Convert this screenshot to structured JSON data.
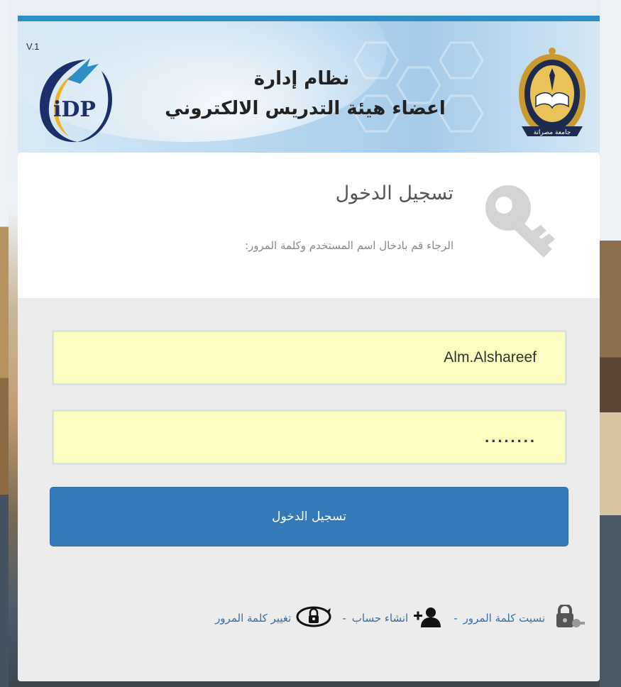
{
  "header": {
    "version": "V.1",
    "logo_text": "iDP",
    "title_line1": "نظام إدارة",
    "title_line2": "اعضاء هيئة التدريس الالكتروني",
    "crest_ribbon": "جامعة مصراتة"
  },
  "login": {
    "heading": "تسجيل الدخول",
    "subheading": "الرجاء قم بادخال اسم المستخدم وكلمة المرور:",
    "username_value": "Alm.Alshareef",
    "password_value": "........",
    "submit_label": "تسجيل الدخول"
  },
  "links": {
    "forgot_password": "نسيت كلمة المرور",
    "create_account": "انشاء حساب",
    "change_password": "تغيير كلمة المرور",
    "separator": "-"
  },
  "colors": {
    "accent": "#347ab7",
    "banner_border": "#2e8fc6",
    "input_bg": "#fbfdc0",
    "link": "#3a6ea5"
  },
  "icons": [
    "idp-logo",
    "university-crest-icon",
    "key-icon",
    "lock-key-icon",
    "add-user-icon",
    "refresh-lock-icon"
  ]
}
